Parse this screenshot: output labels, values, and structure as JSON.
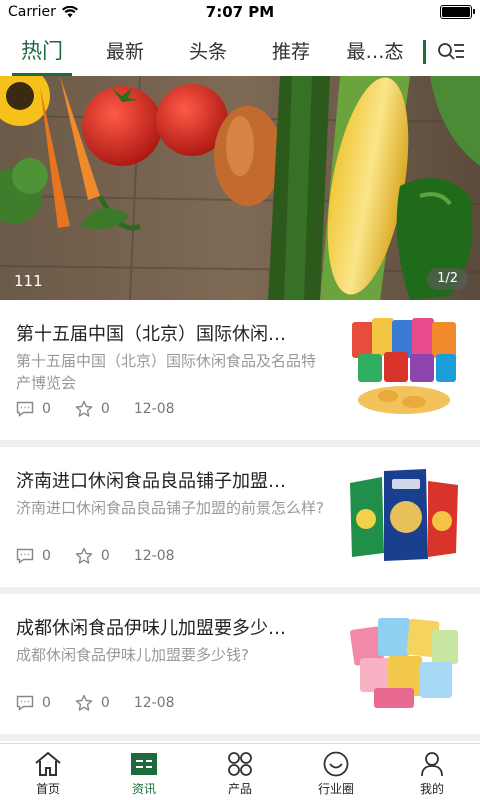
{
  "status_bar": {
    "carrier": "Carrier",
    "time": "7:07 PM"
  },
  "tabs": [
    {
      "label": "热门",
      "active": true
    },
    {
      "label": "最新",
      "active": false
    },
    {
      "label": "头条",
      "active": false
    },
    {
      "label": "推荐",
      "active": false
    },
    {
      "label": "最…态",
      "active": false
    }
  ],
  "colors": {
    "accent": "#1f6a3d",
    "separator": "#efefef"
  },
  "banner": {
    "caption": "111",
    "pager": "1/2"
  },
  "articles": [
    {
      "title": "第十五届中国（北京）国际休闲…",
      "summary": "第十五届中国（北京）国际休闲食品及名品特产博览会",
      "comments": "0",
      "likes": "0",
      "date": "12-08"
    },
    {
      "title": "济南进口休闲食品良品铺子加盟…",
      "summary": "济南进口休闲食品良品铺子加盟的前景怎么样?",
      "comments": "0",
      "likes": "0",
      "date": "12-08"
    },
    {
      "title": "成都休闲食品伊味儿加盟要多少…",
      "summary": "成都休闲食品伊味儿加盟要多少钱?",
      "comments": "0",
      "likes": "0",
      "date": "12-08"
    }
  ],
  "bottom_nav": [
    {
      "label": "首页",
      "icon": "home-icon",
      "active": false
    },
    {
      "label": "资讯",
      "icon": "news-icon",
      "active": true
    },
    {
      "label": "产品",
      "icon": "grid-icon",
      "active": false
    },
    {
      "label": "行业圈",
      "icon": "smile-icon",
      "active": false
    },
    {
      "label": "我的",
      "icon": "user-icon",
      "active": false
    }
  ]
}
